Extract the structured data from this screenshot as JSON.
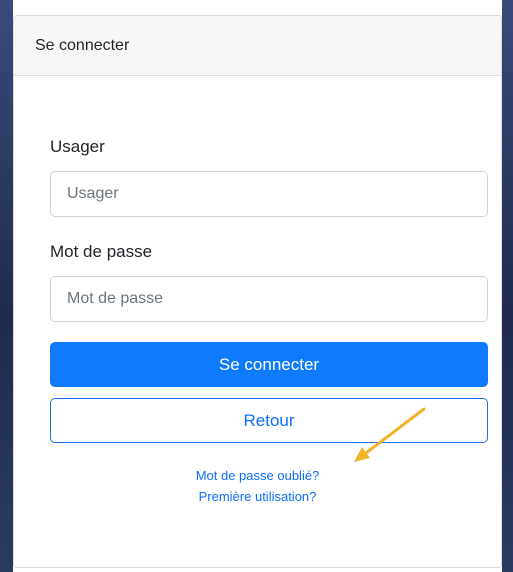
{
  "header": {
    "title": "Se connecter"
  },
  "form": {
    "username": {
      "label": "Usager",
      "placeholder": "Usager",
      "value": ""
    },
    "password": {
      "label": "Mot de passe",
      "placeholder": "Mot de passe",
      "value": ""
    },
    "submit_label": "Se connecter",
    "back_label": "Retour"
  },
  "links": {
    "forgot_password": "Mot de passe oublié?",
    "first_use": "Première utilisation?"
  },
  "annotation": {
    "arrow_color": "#f0b429"
  },
  "colors": {
    "primary": "#0d7bfc",
    "link": "#0d6efd",
    "background_edge": "#2c3a63"
  }
}
